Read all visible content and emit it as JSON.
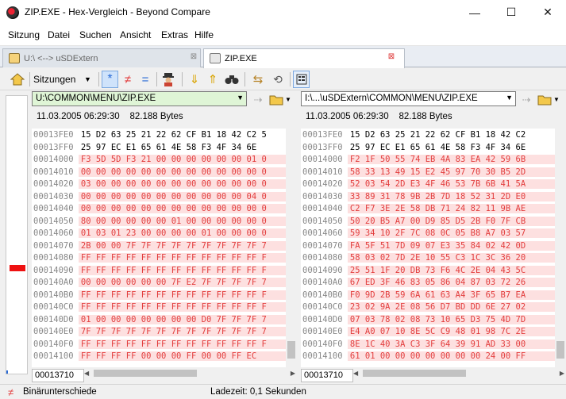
{
  "window": {
    "title": "ZIP.EXE - Hex-Vergleich - Beyond Compare",
    "minimize": "—",
    "maximize": "☐",
    "close": "✕"
  },
  "menu": [
    "Sitzung",
    "Datei",
    "Suchen",
    "Ansicht",
    "Extras",
    "Hilfe"
  ],
  "tabs": [
    {
      "label": "U:\\ <--> uSDExtern",
      "close": "⊠"
    },
    {
      "label": "ZIP.EXE",
      "close": "⊠"
    }
  ],
  "toolbar": {
    "sessions_label": "Sitzungen",
    "all_icon": "*",
    "diffs_icon": "≠",
    "same_icon": "=",
    "colors": {
      "accent": "#2a6bd6",
      "diff": "#e23d3d",
      "diff_bg": "#fde0e0",
      "path_left_bg": "#dff5d6"
    }
  },
  "left": {
    "path": "U:\\COMMON\\MENU\\ZIP.EXE",
    "date": "11.03.2005 06:29:30",
    "size": "82.188 Bytes",
    "position": "00013710"
  },
  "right": {
    "path": "I:\\...\\uSDExtern\\COMMON\\MENU\\ZIP.EXE",
    "date": "11.03.2005 06:29:30",
    "size": "82.188 Bytes",
    "position": "00013710"
  },
  "offsets": [
    "00013FE0",
    "00013FF0",
    "00014000",
    "00014010",
    "00014020",
    "00014030",
    "00014040",
    "00014050",
    "00014060",
    "00014070",
    "00014080",
    "00014090",
    "000140A0",
    "000140B0",
    "000140C0",
    "000140D0",
    "000140E0",
    "000140F0",
    "00014100"
  ],
  "diff_rows": [
    false,
    false,
    true,
    true,
    true,
    true,
    true,
    true,
    true,
    true,
    true,
    true,
    true,
    true,
    true,
    true,
    true,
    true,
    true
  ],
  "left_hex": [
    "15 D2 63 25 21 22 62 CF B1 18 42 C2 5",
    "25 97 EC E1 65 61 4E 58 F3 4F 34 6E",
    "F3 5D 5D F3 21 00 00 00 00 00 00 01 0",
    "00 00 00 00 00 00 00 00 00 00 00 00 0",
    "03 00 00 00 00 00 00 00 00 00 00 00 0",
    "00 00 00 00 00 00 00 00 00 00 00 04 0",
    "00 00 00 00 00 00 00 00 00 00 00 00 0",
    "80 00 00 00 00 00 01 00 00 00 00 00 0",
    "01 03 01 23 00 00 00 00 01 00 00 00 0",
    "2B 00 00 7F 7F 7F 7F 7F 7F 7F 7F 7F 7",
    "FF FF FF FF FF FF FF FF FF FF FF FF F",
    "FF FF FF FF FF FF FF FF FF FF FF FF F",
    "00 00 00 00 00 00 7F E2 7F 7F 7F 7F 7",
    "FF FF FF FF FF FF FF FF FF FF FF FF F",
    "FF FF FF FF FF FF FF FF FF FF FF FF F",
    "01 00 00 00 00 00 00 00 D0 7F 7F 7F 7",
    "7F 7F 7F 7F 7F 7F 7F 7F 7F 7F 7F 7F 7",
    "FF FF FF FF FF FF FF FF FF FF FF FF F",
    "FF FF FF FF 00 00 00 FF 00 00 FF EC"
  ],
  "right_hex": [
    "15 D2 63 25 21 22 62 CF B1 18 42 C2",
    "25 97 EC E1 65 61 4E 58 F3 4F 34 6E",
    "F2 1F 50 55 74 EB 4A 83 EA 42 59 6B",
    "58 33 13 49 15 E2 45 97 70 30 B5 2D",
    "52 03 54 2D E3 4F 46 53 7B 6B 41 5A",
    "33 89 31 78 9B 2B 7D 18 52 31 2D E0",
    "C2 F7 3E 2E 58 DB 71 24 82 11 9B AE",
    "50 20 B5 A7 00 D9 85 D5 2B F0 7F CB",
    "59 34 10 2F 7C 08 0C 05 B8 A7 03 57",
    "FA 5F 51 7D 09 07 E3 35 84 02 42 0D",
    "58 03 02 7D 2E 10 55 C3 1C 3C 36 20",
    "25 51 1F 20 DB 73 F6 4C 2E 04 43 5C",
    "67 ED 3F 46 83 05 86 04 87 03 72 26",
    "F0 9D 2B 59 6A 61 63 A4 3F 65 B7 EA",
    "23 02 9A 2E 08 56 D7 BD DD 6E 27 02",
    "07 03 78 02 08 73 10 65 D3 75 4D 7D",
    "E4 A0 07 10 8E 5C C9 48 01 98 7C 2E",
    "8E 1C 40 3A C3 3F 64 39 91 AD 33 00",
    "61 01 00 00 00 00 00 00 00 24 00 FF"
  ],
  "status": {
    "diff_icon": "≠",
    "diff_text": "Binärunterschiede",
    "load_time": "Ladezeit: 0,1 Sekunden"
  }
}
